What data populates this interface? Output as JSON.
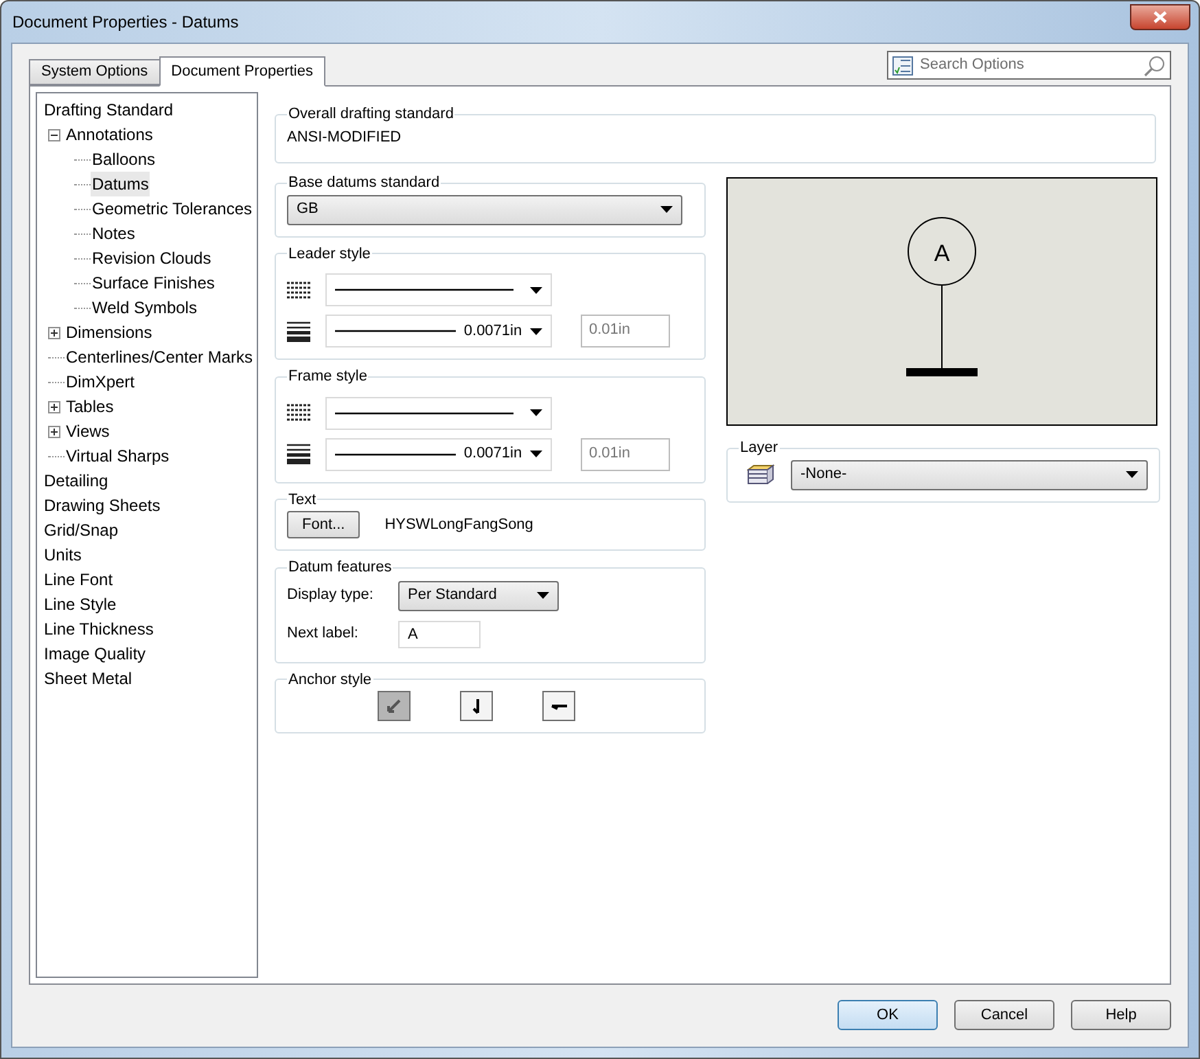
{
  "window": {
    "title": "Document Properties - Datums"
  },
  "tabs": [
    {
      "label": "System Options",
      "selected": false
    },
    {
      "label": "Document Properties",
      "selected": true
    }
  ],
  "search": {
    "placeholder": "Search Options"
  },
  "tree": [
    {
      "label": "Drafting Standard",
      "selected": false,
      "children": [
        {
          "label": "Annotations",
          "selected": false,
          "expanded": true,
          "children": [
            {
              "label": "Balloons",
              "selected": false
            },
            {
              "label": "Datums",
              "selected": true
            },
            {
              "label": "Geometric Tolerances",
              "selected": false
            },
            {
              "label": "Notes",
              "selected": false
            },
            {
              "label": "Revision Clouds",
              "selected": false
            },
            {
              "label": "Surface Finishes",
              "selected": false
            },
            {
              "label": "Weld Symbols",
              "selected": false
            }
          ]
        },
        {
          "label": "Dimensions",
          "selected": false,
          "expanded": false
        },
        {
          "label": "Centerlines/Center Marks",
          "selected": false
        },
        {
          "label": "DimXpert",
          "selected": false
        },
        {
          "label": "Tables",
          "selected": false,
          "expanded": false
        },
        {
          "label": "Views",
          "selected": false,
          "expanded": false
        },
        {
          "label": "Virtual Sharps",
          "selected": false
        }
      ]
    },
    {
      "label": "Detailing",
      "selected": false
    },
    {
      "label": "Drawing Sheets",
      "selected": false
    },
    {
      "label": "Grid/Snap",
      "selected": false
    },
    {
      "label": "Units",
      "selected": false
    },
    {
      "label": "Line Font",
      "selected": false
    },
    {
      "label": "Line Style",
      "selected": false
    },
    {
      "label": "Line Thickness",
      "selected": false
    },
    {
      "label": "Image Quality",
      "selected": false
    },
    {
      "label": "Sheet Metal",
      "selected": false
    }
  ],
  "overall": {
    "title": "Overall drafting standard",
    "value": "ANSI-MODIFIED"
  },
  "base_datums": {
    "title": "Base datums standard",
    "value": "GB"
  },
  "line_groups": [
    {
      "title": "Leader style",
      "rows": [
        {
          "kind": "style"
        },
        {
          "kind": "thickness",
          "value": "0.0071in",
          "custom": "0.01in"
        }
      ]
    },
    {
      "title": "Frame style",
      "rows": [
        {
          "kind": "style"
        },
        {
          "kind": "thickness",
          "value": "0.0071in",
          "custom": "0.01in"
        }
      ]
    }
  ],
  "text_group": {
    "title": "Text",
    "button": "Font...",
    "font": "HYSWLongFangSong"
  },
  "datum_features": {
    "title": "Datum features",
    "display_label": "Display type:",
    "display_value": "Per Standard",
    "next_label": "Next label:",
    "next_value": "A"
  },
  "anchor_style": {
    "title": "Anchor style",
    "options": [
      {
        "kind": "filled",
        "selected": true
      },
      {
        "kind": "down",
        "selected": false
      },
      {
        "kind": "left",
        "selected": false
      }
    ]
  },
  "preview": {
    "label": "A"
  },
  "layer": {
    "title": "Layer",
    "value": "-None-"
  },
  "buttons": [
    {
      "label": "OK",
      "default": true
    },
    {
      "label": "Cancel",
      "default": false
    },
    {
      "label": "Help",
      "default": false
    }
  ]
}
